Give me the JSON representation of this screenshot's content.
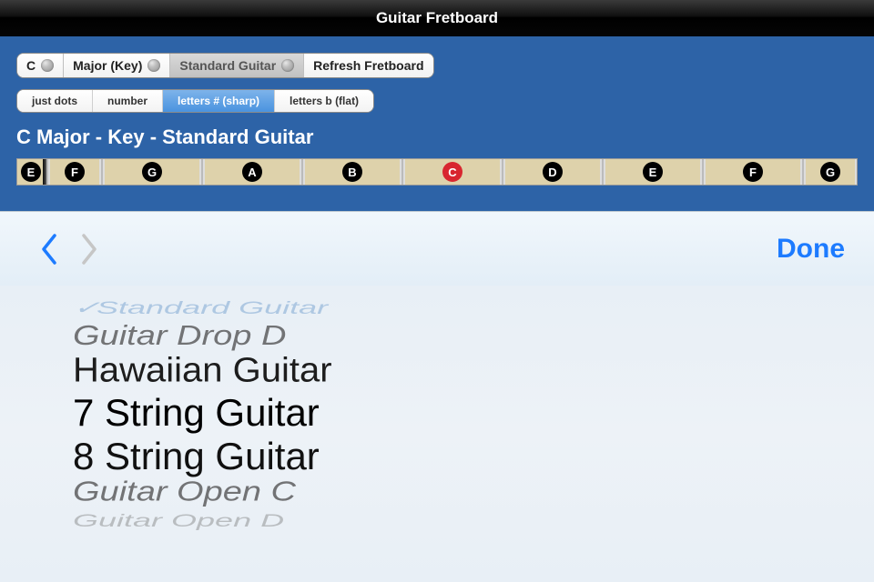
{
  "title": "Guitar Fretboard",
  "selector_bar": {
    "root_note": "C",
    "scale": "Major (Key)",
    "tuning": "Standard Guitar",
    "refresh": "Refresh Fretboard"
  },
  "display_modes": {
    "items": [
      "just dots",
      "number",
      "letters # (sharp)",
      "letters b (flat)"
    ],
    "active_index": 2
  },
  "heading": "C Major - Key - Standard Guitar",
  "fretboard": {
    "open_note": "E",
    "frets": [
      {
        "note": "F",
        "half": true
      },
      {
        "note": "G"
      },
      {
        "note": "A"
      },
      {
        "note": "B"
      },
      {
        "note": "C",
        "root": true
      },
      {
        "note": "D"
      },
      {
        "note": "E"
      },
      {
        "note": "F"
      },
      {
        "note": "G",
        "half": true
      }
    ]
  },
  "picker_bar": {
    "done": "Done"
  },
  "picker": {
    "options": [
      "Standard Guitar",
      "Guitar Drop D",
      "Hawaiian Guitar",
      "7 String Guitar",
      "8 String Guitar",
      "Guitar Open C",
      "Guitar Open D"
    ],
    "selected_index": 0
  }
}
